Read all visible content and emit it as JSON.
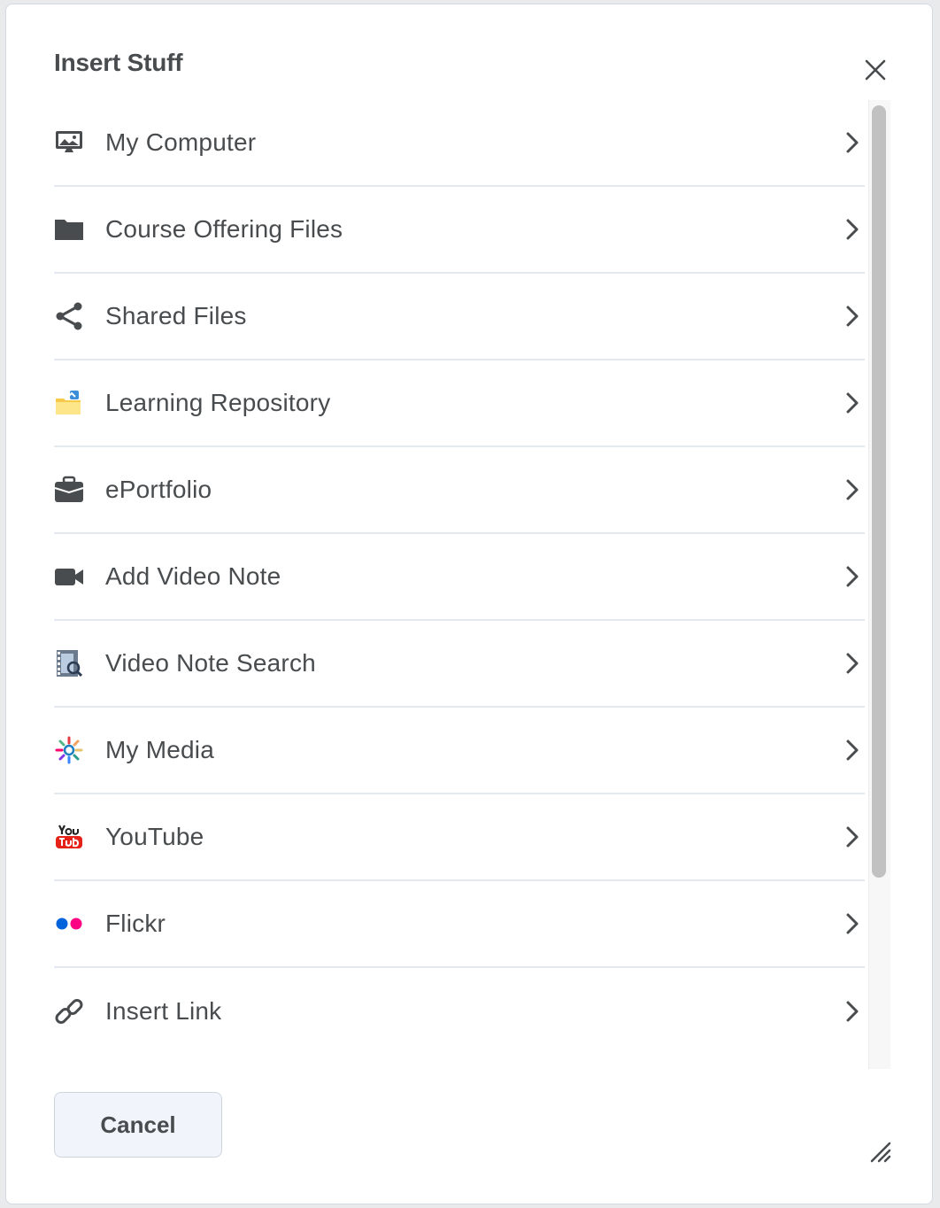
{
  "dialog": {
    "title": "Insert Stuff",
    "close_icon": "close-icon",
    "items": [
      {
        "label": "My Computer",
        "icon": "computer-icon"
      },
      {
        "label": "Course Offering Files",
        "icon": "folder-icon"
      },
      {
        "label": "Shared Files",
        "icon": "share-icon"
      },
      {
        "label": "Learning Repository",
        "icon": "repository-icon"
      },
      {
        "label": "ePortfolio",
        "icon": "briefcase-icon"
      },
      {
        "label": "Add Video Note",
        "icon": "video-camera-icon"
      },
      {
        "label": "Video Note Search",
        "icon": "video-search-icon"
      },
      {
        "label": "My Media",
        "icon": "my-media-icon"
      },
      {
        "label": "YouTube",
        "icon": "youtube-icon"
      },
      {
        "label": "Flickr",
        "icon": "flickr-icon"
      },
      {
        "label": "Insert Link",
        "icon": "link-icon"
      }
    ],
    "cancel_label": "Cancel"
  },
  "colors": {
    "text": "#494c4e",
    "divider": "#e3e9f1",
    "button_bg": "#f1f5fb",
    "youtube_red": "#e62117",
    "flickr_blue": "#0063dc",
    "flickr_pink": "#ff0084"
  }
}
